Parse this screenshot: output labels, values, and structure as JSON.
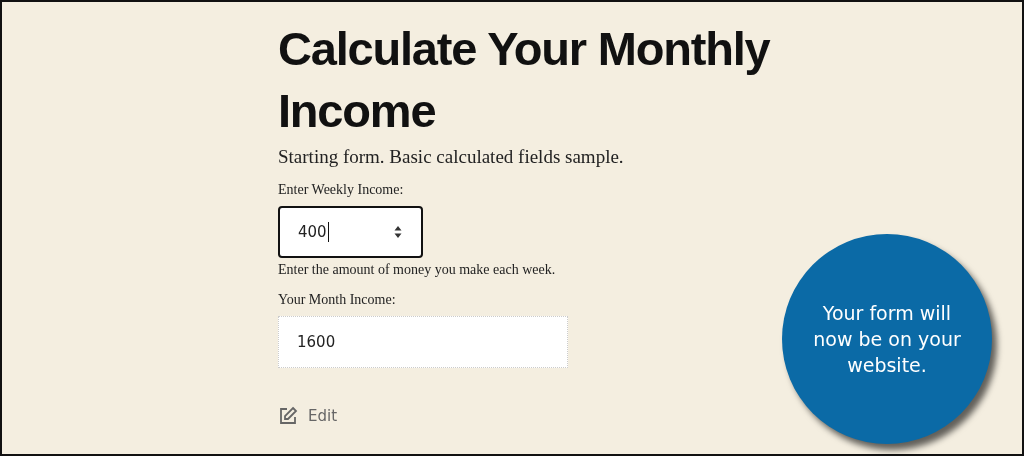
{
  "title": "Calculate Your Monthly Income",
  "description": "Starting form. Basic calculated fields sample.",
  "fields": [
    {
      "kind": "number",
      "label": "Enter Weekly Income:",
      "value": "400",
      "focused": true,
      "help": "Enter the amount of money you make each week."
    },
    {
      "kind": "readonly",
      "label": "Your Month Income:",
      "value": "1600",
      "focused": false
    }
  ],
  "edit_link": "Edit",
  "callout": "Your form will now be on your website."
}
